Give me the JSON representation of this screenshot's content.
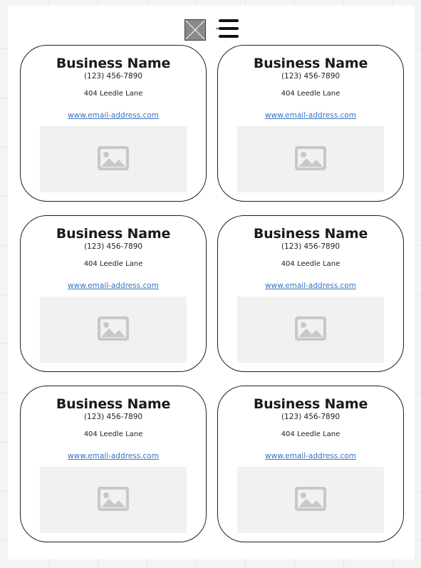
{
  "toolbar": {
    "close_icon": "x-box-icon",
    "menu_icon": "hamburger-menu-icon"
  },
  "colors": {
    "link": "#3b72c4",
    "card_border": "#1f1f1f",
    "image_placeholder_bg": "#f1f1f1",
    "image_icon": "#c8c8c8"
  },
  "cards": [
    {
      "title": "Business Name",
      "phone": "(123) 456-7890",
      "address": "404 Leedle Lane",
      "link": "www.email-address.com",
      "image_icon": "image-placeholder-icon"
    },
    {
      "title": "Business Name",
      "phone": "(123) 456-7890",
      "address": "404 Leedle Lane",
      "link": "www.email-address.com",
      "image_icon": "image-placeholder-icon"
    },
    {
      "title": "Business Name",
      "phone": "(123) 456-7890",
      "address": "404 Leedle Lane",
      "link": "www.email-address.com",
      "image_icon": "image-placeholder-icon"
    },
    {
      "title": "Business Name",
      "phone": "(123) 456-7890",
      "address": "404 Leedle Lane",
      "link": "www.email-address.com",
      "image_icon": "image-placeholder-icon"
    },
    {
      "title": "Business Name",
      "phone": "(123) 456-7890",
      "address": "404 Leedle Lane",
      "link": "www.email-address.com",
      "image_icon": "image-placeholder-icon"
    },
    {
      "title": "Business Name",
      "phone": "(123) 456-7890",
      "address": "404 Leedle Lane",
      "link": "www.email-address.com",
      "image_icon": "image-placeholder-icon"
    }
  ]
}
